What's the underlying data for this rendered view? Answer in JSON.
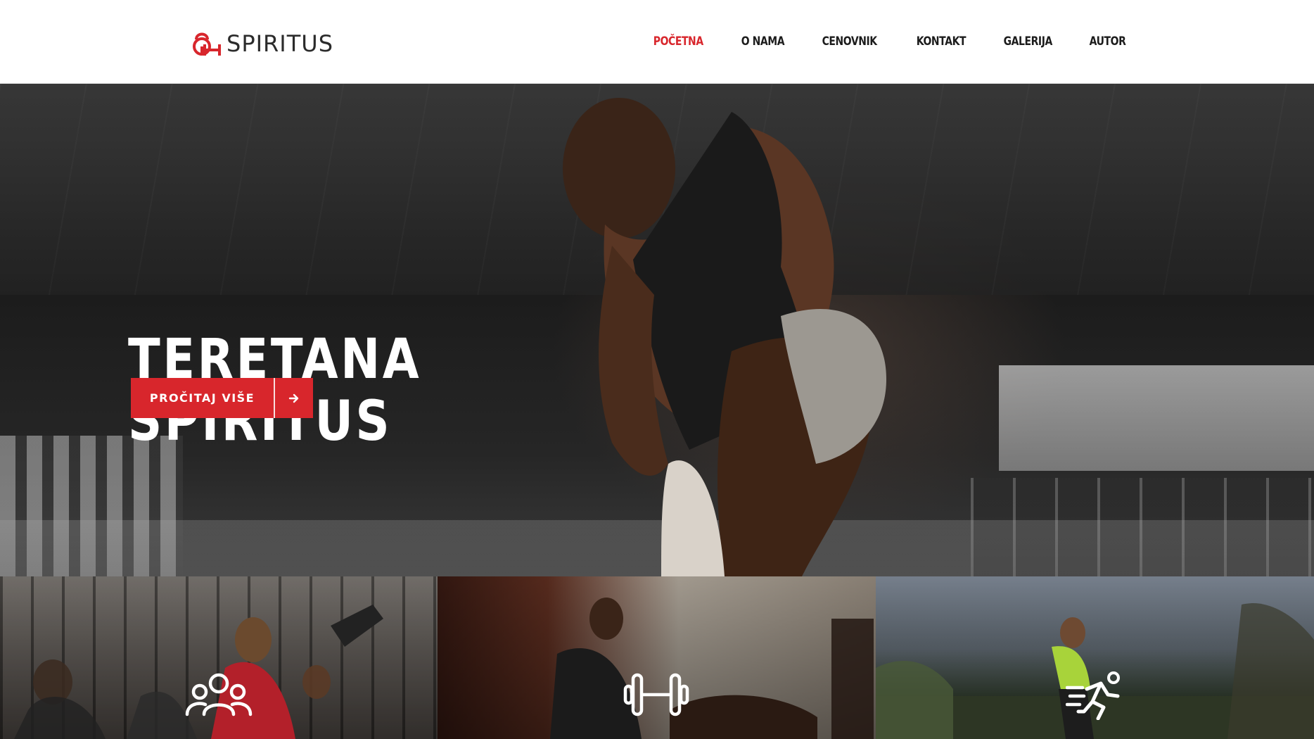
{
  "brand": {
    "name": "SPIRITUS",
    "accent_color": "#d8262c",
    "logo_icon": "kettlebell-dumbbell-icon"
  },
  "nav": {
    "items": [
      {
        "label": "POČETNA",
        "active": true
      },
      {
        "label": "O NAMA",
        "active": false
      },
      {
        "label": "CENOVNIK",
        "active": false
      },
      {
        "label": "KONTAKT",
        "active": false
      },
      {
        "label": "GALERIJA",
        "active": false
      },
      {
        "label": "AUTOR",
        "active": false
      }
    ]
  },
  "hero": {
    "title_line1": "TERETANA",
    "title_line2": "SPIRITUS",
    "cta_label": "PROČITAJ VIŠE",
    "cta_icon": "arrow-right-icon"
  },
  "tiles": [
    {
      "icon": "group-icon"
    },
    {
      "icon": "dumbbell-icon"
    },
    {
      "icon": "runner-icon"
    }
  ]
}
